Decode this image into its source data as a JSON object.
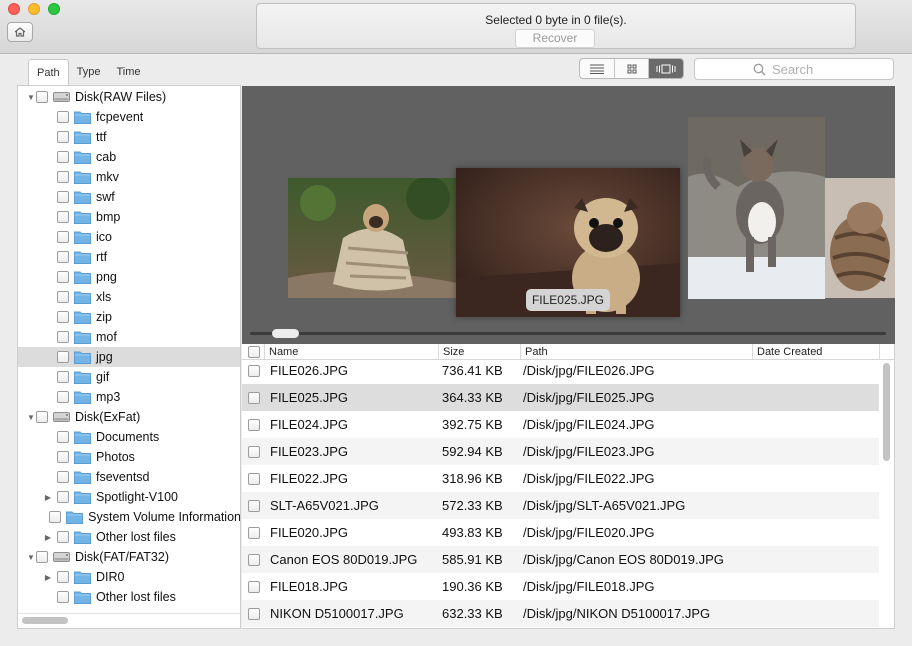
{
  "status": {
    "text": "Selected 0 byte in 0 file(s).",
    "recover_label": "Recover"
  },
  "tabs": [
    {
      "label": "Path",
      "active": true
    },
    {
      "label": "Type",
      "active": false
    },
    {
      "label": "Time",
      "active": false
    }
  ],
  "view_modes": [
    {
      "icon": "list-view-icon",
      "active": false
    },
    {
      "icon": "grid-view-icon",
      "active": false
    },
    {
      "icon": "coverflow-view-icon",
      "active": true
    }
  ],
  "search": {
    "placeholder": "Search",
    "icon": "search-icon"
  },
  "tree": [
    {
      "label": "Disk(RAW Files)",
      "level": 0,
      "type": "disk",
      "expanded": true
    },
    {
      "label": "fcpevent",
      "level": 1,
      "type": "folder"
    },
    {
      "label": "ttf",
      "level": 1,
      "type": "folder"
    },
    {
      "label": "cab",
      "level": 1,
      "type": "folder"
    },
    {
      "label": "mkv",
      "level": 1,
      "type": "folder"
    },
    {
      "label": "swf",
      "level": 1,
      "type": "folder"
    },
    {
      "label": "bmp",
      "level": 1,
      "type": "folder"
    },
    {
      "label": "ico",
      "level": 1,
      "type": "folder"
    },
    {
      "label": "rtf",
      "level": 1,
      "type": "folder"
    },
    {
      "label": "png",
      "level": 1,
      "type": "folder"
    },
    {
      "label": "xls",
      "level": 1,
      "type": "folder"
    },
    {
      "label": "zip",
      "level": 1,
      "type": "folder"
    },
    {
      "label": "mof",
      "level": 1,
      "type": "folder"
    },
    {
      "label": "jpg",
      "level": 1,
      "type": "folder",
      "selected": true
    },
    {
      "label": "gif",
      "level": 1,
      "type": "folder"
    },
    {
      "label": "mp3",
      "level": 1,
      "type": "folder"
    },
    {
      "label": "Disk(ExFat)",
      "level": 0,
      "type": "disk",
      "expanded": true
    },
    {
      "label": "Documents",
      "level": 1,
      "type": "folder"
    },
    {
      "label": "Photos",
      "level": 1,
      "type": "folder"
    },
    {
      "label": "fseventsd",
      "level": 1,
      "type": "folder"
    },
    {
      "label": "Spotlight-V100",
      "level": 1,
      "type": "folder",
      "collapsed": true
    },
    {
      "label": "System Volume Information",
      "level": 1,
      "type": "folder"
    },
    {
      "label": "Other lost files",
      "level": 1,
      "type": "folder",
      "collapsed": true
    },
    {
      "label": "Disk(FAT/FAT32)",
      "level": 0,
      "type": "disk",
      "expanded": true
    },
    {
      "label": "DIR0",
      "level": 1,
      "type": "folder",
      "collapsed": true
    },
    {
      "label": "Other lost files",
      "level": 1,
      "type": "folder"
    }
  ],
  "preview": {
    "caption": "FILE025.JPG"
  },
  "columns": {
    "name": "Name",
    "size": "Size",
    "path": "Path",
    "date": "Date Created"
  },
  "files": [
    {
      "name": "FILE026.JPG",
      "size": "736.41 KB",
      "path": "/Disk/jpg/FILE026.JPG",
      "date": ""
    },
    {
      "name": "FILE025.JPG",
      "size": "364.33 KB",
      "path": "/Disk/jpg/FILE025.JPG",
      "date": "",
      "selected": true
    },
    {
      "name": "FILE024.JPG",
      "size": "392.75 KB",
      "path": "/Disk/jpg/FILE024.JPG",
      "date": ""
    },
    {
      "name": "FILE023.JPG",
      "size": "592.94 KB",
      "path": "/Disk/jpg/FILE023.JPG",
      "date": ""
    },
    {
      "name": "FILE022.JPG",
      "size": "318.96 KB",
      "path": "/Disk/jpg/FILE022.JPG",
      "date": ""
    },
    {
      "name": "SLT-A65V021.JPG",
      "size": "572.33 KB",
      "path": "/Disk/jpg/SLT-A65V021.JPG",
      "date": ""
    },
    {
      "name": "FILE020.JPG",
      "size": "493.83 KB",
      "path": "/Disk/jpg/FILE020.JPG",
      "date": ""
    },
    {
      "name": "Canon EOS 80D019.JPG",
      "size": "585.91 KB",
      "path": "/Disk/jpg/Canon EOS 80D019.JPG",
      "date": ""
    },
    {
      "name": "FILE018.JPG",
      "size": "190.36 KB",
      "path": "/Disk/jpg/FILE018.JPG",
      "date": ""
    },
    {
      "name": "NIKON D5100017.JPG",
      "size": "632.33 KB",
      "path": "/Disk/jpg/NIKON D5100017.JPG",
      "date": ""
    }
  ]
}
